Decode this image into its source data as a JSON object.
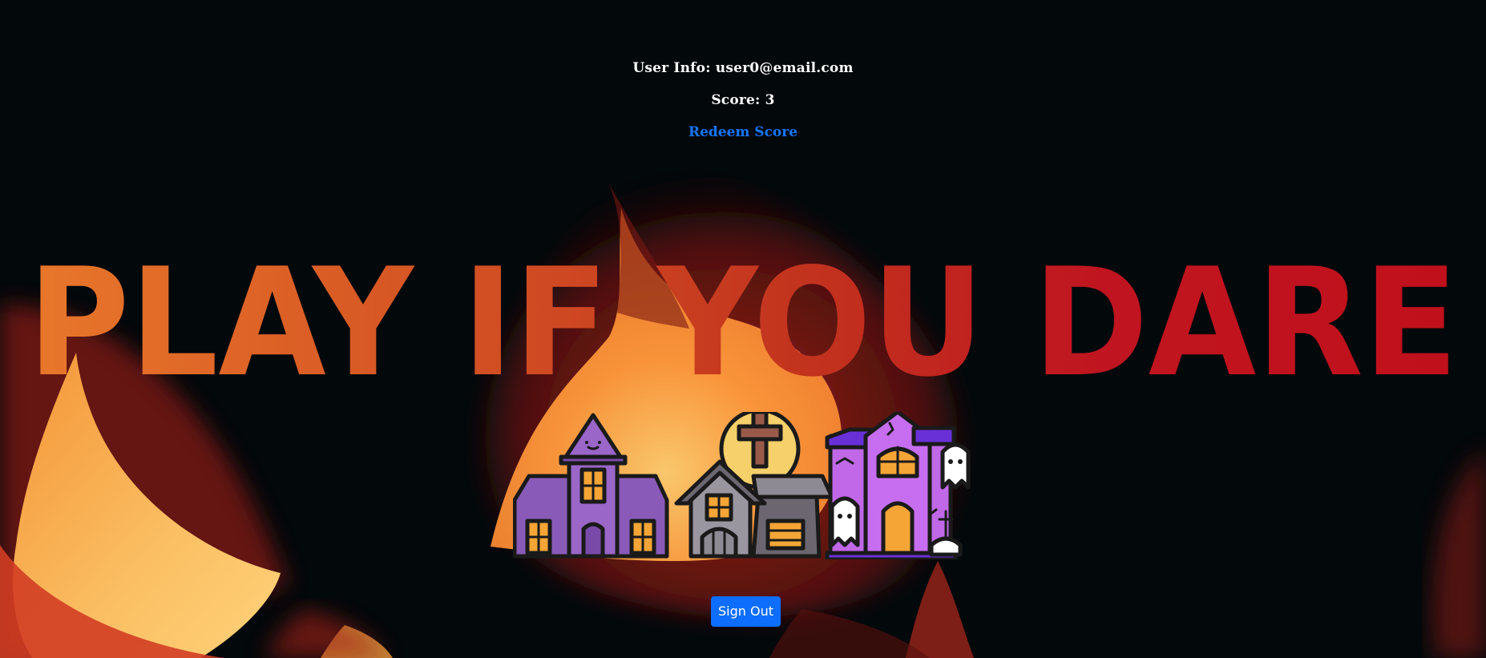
{
  "user_info": {
    "email_line": "User Info: user0@email.com",
    "score_line": "Score: 3",
    "redeem_label": "Redeem Score"
  },
  "hero": {
    "headline": "PLAY IF YOU DARE",
    "gradient_start": "#e8772a",
    "gradient_end": "#c0101c",
    "illustration": "haunted-houses-icon"
  },
  "actions": {
    "sign_out_label": "Sign Out"
  },
  "colors": {
    "background": "#03080b",
    "link": "#1476ff",
    "button": "#0d6efd",
    "flame_outer": "#c8321e",
    "flame_inner": "#ffc266"
  }
}
